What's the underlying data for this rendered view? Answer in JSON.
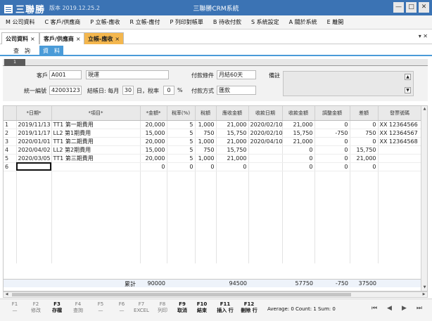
{
  "app": {
    "logo": "三聯勝",
    "version": "版本 2019.12.25.2",
    "window_title": "三聯勝CRM系統",
    "min": "—",
    "max": "□",
    "close": "✕"
  },
  "menu": [
    "M 公司資料",
    "C 客戶/供應商",
    "P 立帳-應收",
    "R 立帳-應付",
    "P 列印對帳單",
    "B 待收付款",
    "S 系統設定",
    "A 關於系統",
    "E 離開"
  ],
  "doc_tabs": [
    {
      "label": "公司資料",
      "close": "×"
    },
    {
      "label": "客戶/供應商",
      "close": "×"
    },
    {
      "label": "立帳-應收",
      "close": "×"
    }
  ],
  "doc_controls": "▾  ✕",
  "sub_tabs": [
    "查　詢",
    "資　料"
  ],
  "section_badge": "1",
  "form": {
    "customer_label": "客戶",
    "customer_code": "A001",
    "customer_name": "現運",
    "tax_id_label": "統一編號",
    "tax_id": "42003123",
    "closing_label": "結帳日: 每月",
    "closing_day": "30",
    "closing_suffix": "日，稅率",
    "tax_rate": "0",
    "percent": "%",
    "pay_term_label": "付款條件",
    "pay_term": "月結60天",
    "pay_method_label": "付款方式",
    "pay_method": "匯款",
    "memo_label": "備註"
  },
  "grid": {
    "columns": [
      "",
      "*日期*",
      "*項目*",
      "*金額*",
      "稅率(%)",
      "稅額",
      "應收金額",
      "收款日期",
      "收款金額",
      "調整金額",
      "差額",
      "發票號碼"
    ],
    "rows": [
      [
        "1",
        "2019/11/13",
        "TT1 第一期費用",
        "20,000",
        "5",
        "1,000",
        "21,000",
        "2020/02/10",
        "21,000",
        "0",
        "0",
        "XX 12364566"
      ],
      [
        "2",
        "2019/11/17",
        "LL2 第1期費用",
        "15,000",
        "5",
        "750",
        "15,750",
        "2020/02/10",
        "15,750",
        "-750",
        "750",
        "XX 12364567"
      ],
      [
        "3",
        "2020/01/01",
        "TT1 第二期費用",
        "20,000",
        "5",
        "1,000",
        "21,000",
        "2020/04/10",
        "21,000",
        "0",
        "0",
        "XX 12364568"
      ],
      [
        "4",
        "2020/04/02",
        "LL2 第2期費用",
        "15,000",
        "5",
        "750",
        "15,750",
        "",
        "0",
        "0",
        "15,750",
        ""
      ],
      [
        "5",
        "2020/03/05",
        "TT1 第三期費用",
        "20,000",
        "5",
        "1,000",
        "21,000",
        "",
        "0",
        "0",
        "21,000",
        ""
      ],
      [
        "6",
        "",
        "",
        "0",
        "0",
        "0",
        "0",
        "",
        "0",
        "0",
        "0",
        ""
      ]
    ],
    "totals": {
      "label": "累計",
      "amount": "90000",
      "receivable": "94500",
      "received": "57750",
      "adjust": "-750",
      "diff": "37500"
    }
  },
  "fkeys": [
    {
      "key": "F1",
      "label": "—",
      "on": false
    },
    {
      "key": "F2",
      "label": "修改",
      "on": false
    },
    {
      "key": "F3",
      "label": "存檔",
      "on": true
    },
    {
      "key": "F4",
      "label": "查詢",
      "on": false
    },
    {
      "key": "F5",
      "label": "—",
      "on": false
    },
    {
      "key": "F6",
      "label": "—",
      "on": false
    },
    {
      "key": "F7",
      "label": "EXCEL",
      "on": false
    },
    {
      "key": "F8",
      "label": "列印",
      "on": false
    },
    {
      "key": "F9",
      "label": "取消",
      "on": true
    },
    {
      "key": "F10",
      "label": "結束",
      "on": true
    },
    {
      "key": "F11",
      "label": "插入 行",
      "on": true
    },
    {
      "key": "F12",
      "label": "刪除 行",
      "on": true
    }
  ],
  "status": "Average: 0  Count: 1  Sum: 0",
  "pager": [
    "⏮",
    "◀",
    "▶",
    "⏭"
  ]
}
